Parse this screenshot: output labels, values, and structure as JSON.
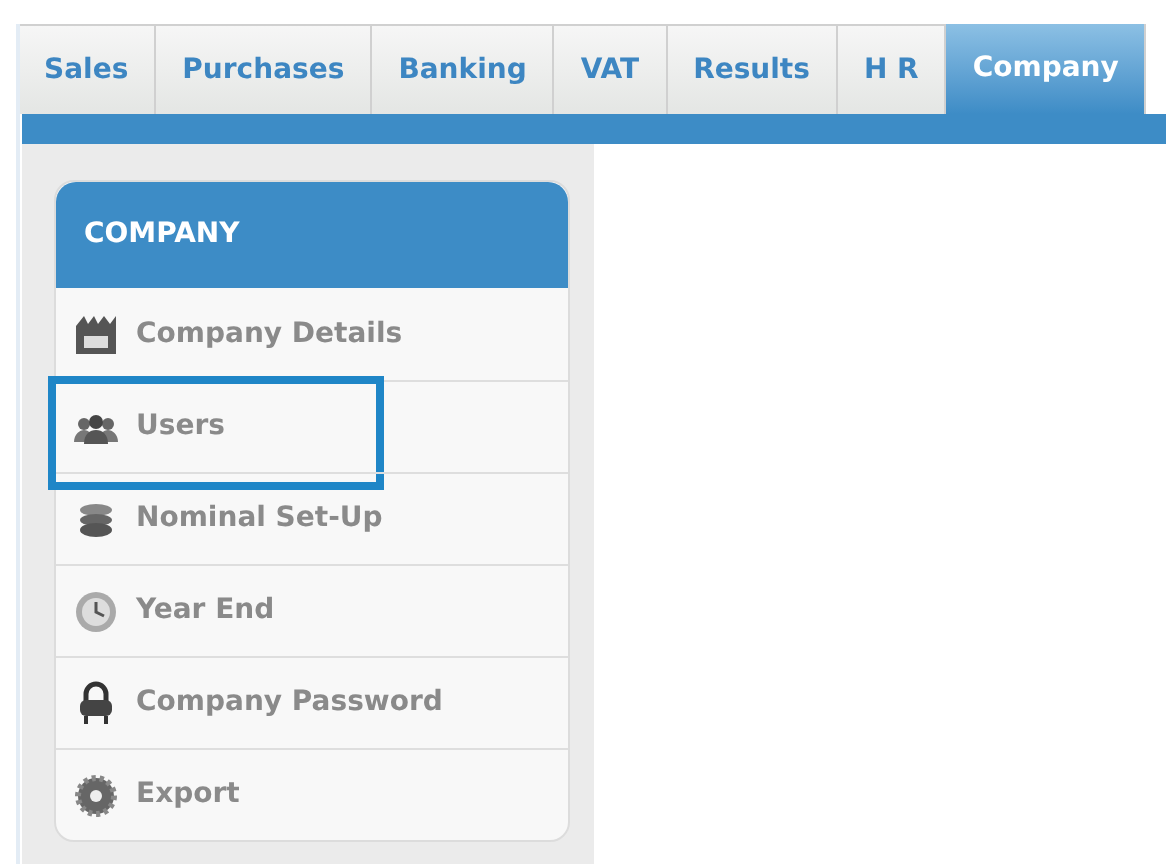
{
  "tabs": [
    {
      "label": "Sales",
      "selected": false
    },
    {
      "label": "Purchases",
      "selected": false
    },
    {
      "label": "Banking",
      "selected": false
    },
    {
      "label": "VAT",
      "selected": false
    },
    {
      "label": "Results",
      "selected": false
    },
    {
      "label": "H R",
      "selected": false
    },
    {
      "label": "Company",
      "selected": true
    }
  ],
  "sidebar": {
    "title": "COMPANY",
    "items": [
      {
        "label": "Company Details",
        "highlighted": false
      },
      {
        "label": "Users",
        "highlighted": true
      },
      {
        "label": "Nominal Set-Up",
        "highlighted": false
      },
      {
        "label": "Year End",
        "highlighted": false
      },
      {
        "label": "Company Password",
        "highlighted": false
      },
      {
        "label": "Export",
        "highlighted": false
      }
    ]
  }
}
